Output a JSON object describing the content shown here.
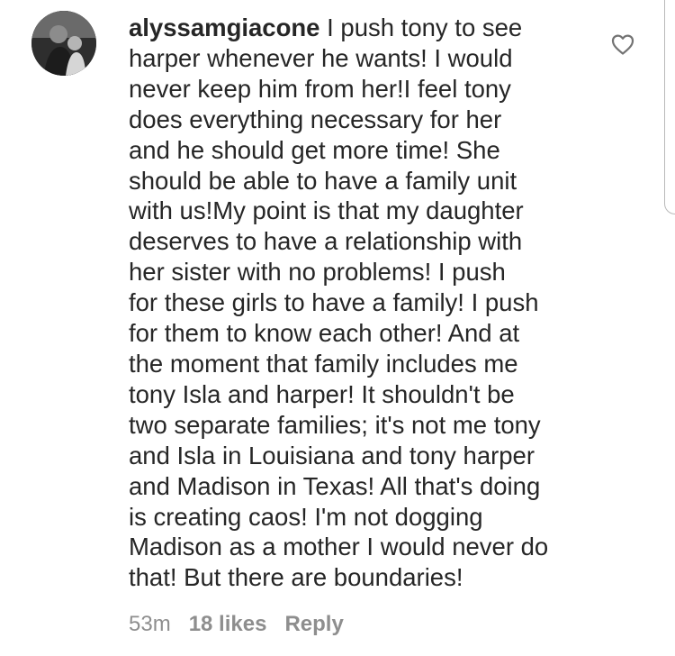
{
  "comment": {
    "username": "alyssamgiacone",
    "text": "I push tony to see\nharper whenever he wants! I would\nnever keep him from her!I feel tony\ndoes everything necessary for her\nand he should get more time! She\nshould be able to have a family unit\nwith us!My point is that my daughter\ndeserves to have a relationship with\nher sister with no problems! I push\nfor these girls to have a family! I push\nfor them to know each other!  And at\nthe moment that family includes me\ntony Isla and harper! It shouldn't be\ntwo separate families; it's not me tony\nand Isla in Louisiana and tony harper\nand Madison in Texas! All that's doing\nis creating caos! I'm not dogging\nMadison as a mother I would never do\nthat! But there are boundaries!",
    "time_ago": "53m",
    "likes": "18 likes",
    "reply_label": "Reply",
    "like_icon": "heart-outline-icon",
    "avatar_icon": "user-avatar"
  }
}
